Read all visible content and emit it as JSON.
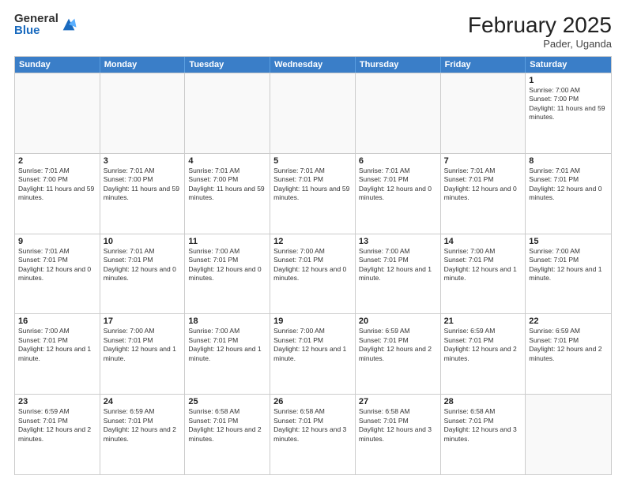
{
  "header": {
    "logo": {
      "general": "General",
      "blue": "Blue"
    },
    "title": "February 2025",
    "subtitle": "Pader, Uganda"
  },
  "calendar": {
    "days": [
      "Sunday",
      "Monday",
      "Tuesday",
      "Wednesday",
      "Thursday",
      "Friday",
      "Saturday"
    ],
    "weeks": [
      [
        {
          "day": null
        },
        {
          "day": null
        },
        {
          "day": null
        },
        {
          "day": null
        },
        {
          "day": null
        },
        {
          "day": null
        },
        {
          "day": 1,
          "sunrise": "7:00 AM",
          "sunset": "7:00 PM",
          "daylight": "11 hours and 59 minutes."
        }
      ],
      [
        {
          "day": 2,
          "sunrise": "7:01 AM",
          "sunset": "7:00 PM",
          "daylight": "11 hours and 59 minutes."
        },
        {
          "day": 3,
          "sunrise": "7:01 AM",
          "sunset": "7:00 PM",
          "daylight": "11 hours and 59 minutes."
        },
        {
          "day": 4,
          "sunrise": "7:01 AM",
          "sunset": "7:00 PM",
          "daylight": "11 hours and 59 minutes."
        },
        {
          "day": 5,
          "sunrise": "7:01 AM",
          "sunset": "7:01 PM",
          "daylight": "11 hours and 59 minutes."
        },
        {
          "day": 6,
          "sunrise": "7:01 AM",
          "sunset": "7:01 PM",
          "daylight": "12 hours and 0 minutes."
        },
        {
          "day": 7,
          "sunrise": "7:01 AM",
          "sunset": "7:01 PM",
          "daylight": "12 hours and 0 minutes."
        },
        {
          "day": 8,
          "sunrise": "7:01 AM",
          "sunset": "7:01 PM",
          "daylight": "12 hours and 0 minutes."
        }
      ],
      [
        {
          "day": 9,
          "sunrise": "7:01 AM",
          "sunset": "7:01 PM",
          "daylight": "12 hours and 0 minutes."
        },
        {
          "day": 10,
          "sunrise": "7:01 AM",
          "sunset": "7:01 PM",
          "daylight": "12 hours and 0 minutes."
        },
        {
          "day": 11,
          "sunrise": "7:00 AM",
          "sunset": "7:01 PM",
          "daylight": "12 hours and 0 minutes."
        },
        {
          "day": 12,
          "sunrise": "7:00 AM",
          "sunset": "7:01 PM",
          "daylight": "12 hours and 0 minutes."
        },
        {
          "day": 13,
          "sunrise": "7:00 AM",
          "sunset": "7:01 PM",
          "daylight": "12 hours and 1 minute."
        },
        {
          "day": 14,
          "sunrise": "7:00 AM",
          "sunset": "7:01 PM",
          "daylight": "12 hours and 1 minute."
        },
        {
          "day": 15,
          "sunrise": "7:00 AM",
          "sunset": "7:01 PM",
          "daylight": "12 hours and 1 minute."
        }
      ],
      [
        {
          "day": 16,
          "sunrise": "7:00 AM",
          "sunset": "7:01 PM",
          "daylight": "12 hours and 1 minute."
        },
        {
          "day": 17,
          "sunrise": "7:00 AM",
          "sunset": "7:01 PM",
          "daylight": "12 hours and 1 minute."
        },
        {
          "day": 18,
          "sunrise": "7:00 AM",
          "sunset": "7:01 PM",
          "daylight": "12 hours and 1 minute."
        },
        {
          "day": 19,
          "sunrise": "7:00 AM",
          "sunset": "7:01 PM",
          "daylight": "12 hours and 1 minute."
        },
        {
          "day": 20,
          "sunrise": "6:59 AM",
          "sunset": "7:01 PM",
          "daylight": "12 hours and 2 minutes."
        },
        {
          "day": 21,
          "sunrise": "6:59 AM",
          "sunset": "7:01 PM",
          "daylight": "12 hours and 2 minutes."
        },
        {
          "day": 22,
          "sunrise": "6:59 AM",
          "sunset": "7:01 PM",
          "daylight": "12 hours and 2 minutes."
        }
      ],
      [
        {
          "day": 23,
          "sunrise": "6:59 AM",
          "sunset": "7:01 PM",
          "daylight": "12 hours and 2 minutes."
        },
        {
          "day": 24,
          "sunrise": "6:59 AM",
          "sunset": "7:01 PM",
          "daylight": "12 hours and 2 minutes."
        },
        {
          "day": 25,
          "sunrise": "6:58 AM",
          "sunset": "7:01 PM",
          "daylight": "12 hours and 2 minutes."
        },
        {
          "day": 26,
          "sunrise": "6:58 AM",
          "sunset": "7:01 PM",
          "daylight": "12 hours and 3 minutes."
        },
        {
          "day": 27,
          "sunrise": "6:58 AM",
          "sunset": "7:01 PM",
          "daylight": "12 hours and 3 minutes."
        },
        {
          "day": 28,
          "sunrise": "6:58 AM",
          "sunset": "7:01 PM",
          "daylight": "12 hours and 3 minutes."
        },
        {
          "day": null
        }
      ]
    ]
  }
}
